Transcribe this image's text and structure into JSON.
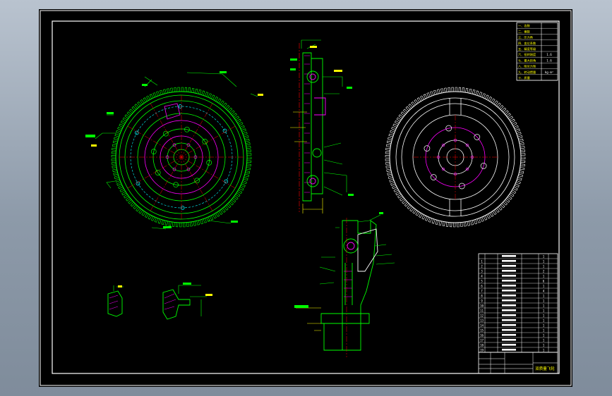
{
  "colors": {
    "background": "#8d9aa9",
    "sheet": "#000000",
    "frame": "#ffffff",
    "outline": "#00ff00",
    "centerline": "#ff0000",
    "dimension": "#ffff00",
    "hidden": "#00ffff",
    "hatch": "#ff00ff"
  },
  "drawing": {
    "views": [
      "flywheel-front-view",
      "flywheel-section-view",
      "flywheel-rear-view",
      "hub-detail-view",
      "ring-profile-small",
      "ring-profile-large"
    ]
  },
  "title_block": {
    "label": "双质量飞轮"
  },
  "tech_table": {
    "rows": [
      "一、齿数",
      "二、模数",
      "三、压力角",
      "四、变位系数",
      "五、精度等级",
      "六、扭转刚度",
      "七、最大转角",
      "八、阻尼力矩",
      "九、转动惯量",
      "十、质量"
    ],
    "values": [
      "",
      "",
      "",
      "",
      "",
      "1.6",
      "1.6",
      "",
      "kg·m²",
      ""
    ]
  },
  "parts_list": {
    "codes": [
      "",
      "1",
      "2",
      "3",
      "4",
      "5",
      "6",
      "7",
      "8",
      "9",
      "10",
      "11",
      "12",
      "13",
      "14",
      "15",
      "16",
      "17",
      "18",
      "19"
    ],
    "qty": [
      "1",
      "1",
      "1",
      "2",
      "1",
      "6",
      "1",
      "4",
      "1",
      "1",
      "1",
      "1",
      "1",
      "1",
      "1",
      "1",
      "1",
      "1",
      "1",
      "1"
    ]
  }
}
